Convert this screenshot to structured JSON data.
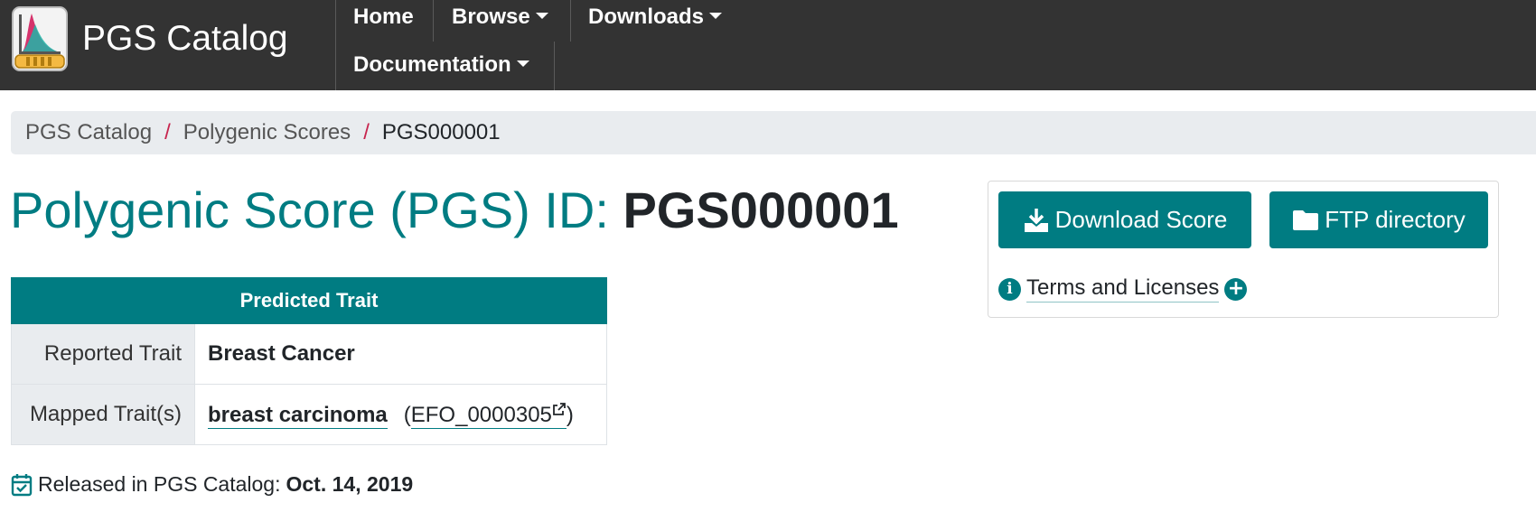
{
  "brand": {
    "name": "PGS Catalog",
    "logo_icon": "pgs-logo-icon"
  },
  "nav": {
    "home": "Home",
    "browse": "Browse",
    "downloads": "Downloads",
    "documentation": "Documentation"
  },
  "breadcrumb": {
    "items": [
      "PGS Catalog",
      "Polygenic Scores",
      "PGS000001"
    ],
    "separator": "/"
  },
  "title": {
    "prefix": "Polygenic Score (PGS) ID: ",
    "id": "PGS000001"
  },
  "trait_table": {
    "header": "Predicted Trait",
    "rows": [
      {
        "label": "Reported Trait",
        "value": "Breast Cancer"
      },
      {
        "label": "Mapped Trait(s)",
        "value": "breast carcinoma",
        "efo_open": "(",
        "efo_id": "EFO_0000305",
        "efo_close": ")"
      }
    ]
  },
  "released": {
    "label": "Released in PGS Catalog:",
    "date": "Oct. 14, 2019"
  },
  "downloads_box": {
    "download_label": "Download Score",
    "ftp_label": "FTP directory",
    "terms_label": "Terms and Licenses"
  },
  "colors": {
    "navbar": "#333333",
    "accent": "#007c82",
    "breadcrumb_bg": "#e9ecef",
    "separator": "#c7254e"
  }
}
